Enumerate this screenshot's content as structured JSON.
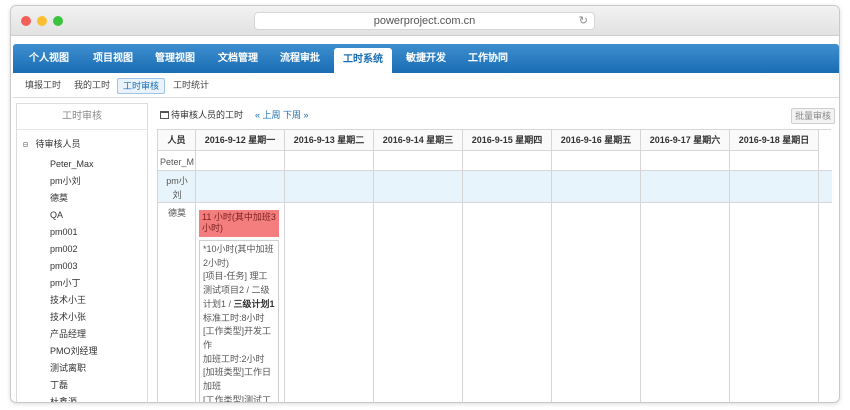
{
  "browser": {
    "url": "powerproject.com.cn"
  },
  "nav": {
    "items": [
      "个人视图",
      "项目视图",
      "管理视图",
      "文档管理",
      "流程审批",
      "工时系统",
      "敏捷开发",
      "工作协同"
    ],
    "active": "工时系统"
  },
  "subnav": {
    "items": [
      "填报工时",
      "我的工时",
      "工时审核",
      "工时统计"
    ],
    "active": "工时审核"
  },
  "sidebar": {
    "title": "工时审核",
    "root_label": "待审核人员",
    "people": [
      "Peter_Max",
      "pm小刘",
      "德莫",
      "QA",
      "pm001",
      "pm002",
      "pm003",
      "pm小丁",
      "技术小王",
      "技术小张",
      "产品经理",
      "PMO刘经理",
      "测试离职",
      "丁磊",
      "杜鑫源"
    ]
  },
  "main": {
    "toolbar_label": "待审核人员的工时",
    "prev_week": "« 上周",
    "next_week": "下周 »",
    "batch_button": "批量审核",
    "columns": [
      "人员",
      "2016-9-12 星期一",
      "2016-9-13 星期二",
      "2016-9-14 星期三",
      "2016-9-15 星期四",
      "2016-9-16 星期五",
      "2016-9-17 星期六",
      "2016-9-18 星期日"
    ],
    "rows": [
      {
        "person": "Peter_M"
      },
      {
        "person": "pm小刘"
      },
      {
        "person": "德莫"
      }
    ],
    "entry": {
      "summary": "11 小时(其中加班3小时)",
      "detail_lines": [
        "*10小时(其中加班2小时)",
        "[项目-任务] 理工测试项目2 / 二级计划1 / ",
        "三级计划1",
        "标准工时:8小时",
        "[工作类型]开发工作",
        "加班工时:2小时",
        "[加班类型]工作日加班",
        "[工作类型]测试工作"
      ]
    }
  }
}
